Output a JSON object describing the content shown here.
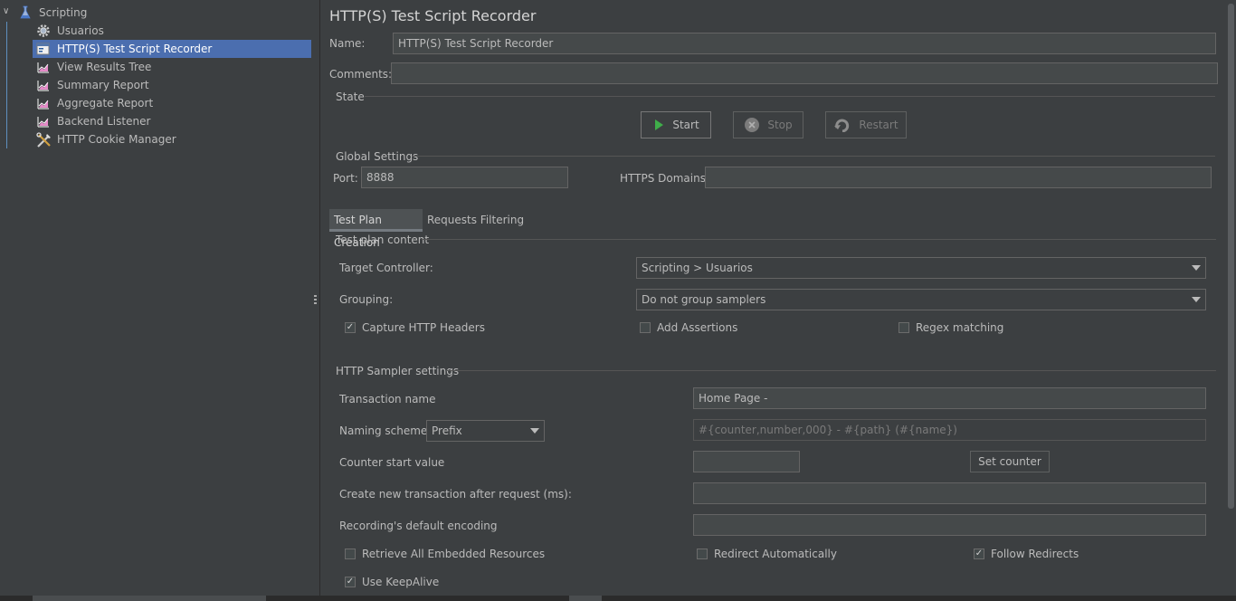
{
  "tree": {
    "root": {
      "label": "Scripting",
      "icon": "flask-icon"
    },
    "items": [
      {
        "label": "Usuarios",
        "icon": "gear-icon"
      },
      {
        "label": "HTTP(S) Test Script Recorder",
        "icon": "recorder-icon",
        "selected": true
      },
      {
        "label": "View Results Tree",
        "icon": "graph-icon"
      },
      {
        "label": "Summary Report",
        "icon": "graph-icon"
      },
      {
        "label": "Aggregate Report",
        "icon": "graph-icon"
      },
      {
        "label": "Backend Listener",
        "icon": "graph-icon"
      },
      {
        "label": "HTTP Cookie Manager",
        "icon": "tools-icon"
      }
    ]
  },
  "panel": {
    "title": "HTTP(S) Test Script Recorder",
    "name_label": "Name:",
    "name_value": "HTTP(S) Test Script Recorder",
    "comments_label": "Comments:",
    "comments_value": "",
    "state_label": "State",
    "start_label": "Start",
    "stop_label": "Stop",
    "restart_label": "Restart",
    "global_settings_label": "Global Settings",
    "port_label": "Port:",
    "port_value": "8888",
    "https_domains_label": "HTTPS Domains:",
    "https_domains_value": ""
  },
  "tabs": [
    {
      "label": "Test Plan Creation",
      "active": true
    },
    {
      "label": "Requests Filtering",
      "active": false
    }
  ],
  "test_plan": {
    "section_label": "Test plan content",
    "target_controller_label": "Target Controller:",
    "target_controller_value": "Scripting > Usuarios",
    "grouping_label": "Grouping:",
    "grouping_value": "Do not group samplers",
    "capture_headers_label": "Capture HTTP Headers",
    "capture_headers_checked": true,
    "add_assertions_label": "Add Assertions",
    "add_assertions_checked": false,
    "regex_matching_label": "Regex matching",
    "regex_matching_checked": false
  },
  "sampler": {
    "section_label": "HTTP Sampler settings",
    "transaction_name_label": "Transaction name",
    "transaction_name_value": "Home Page -",
    "naming_scheme_label": "Naming scheme",
    "naming_scheme_value": "Prefix",
    "naming_pattern_placeholder": "#{counter,number,000} - #{path} (#{name})",
    "counter_start_label": "Counter start value",
    "counter_start_value": "",
    "set_counter_label": "Set counter",
    "new_transaction_label": "Create new transaction after request (ms):",
    "new_transaction_value": "",
    "encoding_label": "Recording's default encoding",
    "encoding_value": "",
    "retrieve_resources_label": "Retrieve All Embedded Resources",
    "retrieve_resources_checked": false,
    "redirect_auto_label": "Redirect Automatically",
    "redirect_auto_checked": false,
    "follow_redirects_label": "Follow Redirects",
    "follow_redirects_checked": true,
    "keepalive_label": "Use KeepAlive",
    "keepalive_checked": true
  },
  "colors": {
    "background": "#3c3f41",
    "selection": "#4b6eaf",
    "field": "#45494a",
    "start_icon": "#3fae4a"
  }
}
